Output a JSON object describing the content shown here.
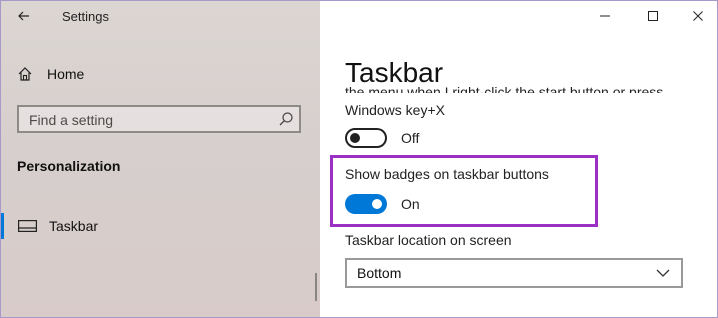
{
  "window": {
    "title": "Settings",
    "controls": [
      "minimize",
      "maximize",
      "close"
    ]
  },
  "sidebar": {
    "home_label": "Home",
    "search_placeholder": "Find a setting",
    "section_title": "Personalization",
    "items": [
      {
        "label": "Taskbar",
        "icon": "taskbar-icon",
        "selected": true
      }
    ]
  },
  "main": {
    "page_title": "Taskbar",
    "cut_off_text": "the menu when I right-click the start button or press",
    "cut_off_text_continued": "Windows key+X",
    "settings": [
      {
        "id": "winx_powershell",
        "state": "Off",
        "on": false
      },
      {
        "id": "show_badges",
        "label": "Show badges on taskbar buttons",
        "state": "On",
        "on": true
      }
    ],
    "location": {
      "label": "Taskbar location on screen",
      "selected": "Bottom"
    }
  },
  "colors": {
    "accent": "#0078d7",
    "highlight_box": "#9b30c4"
  }
}
